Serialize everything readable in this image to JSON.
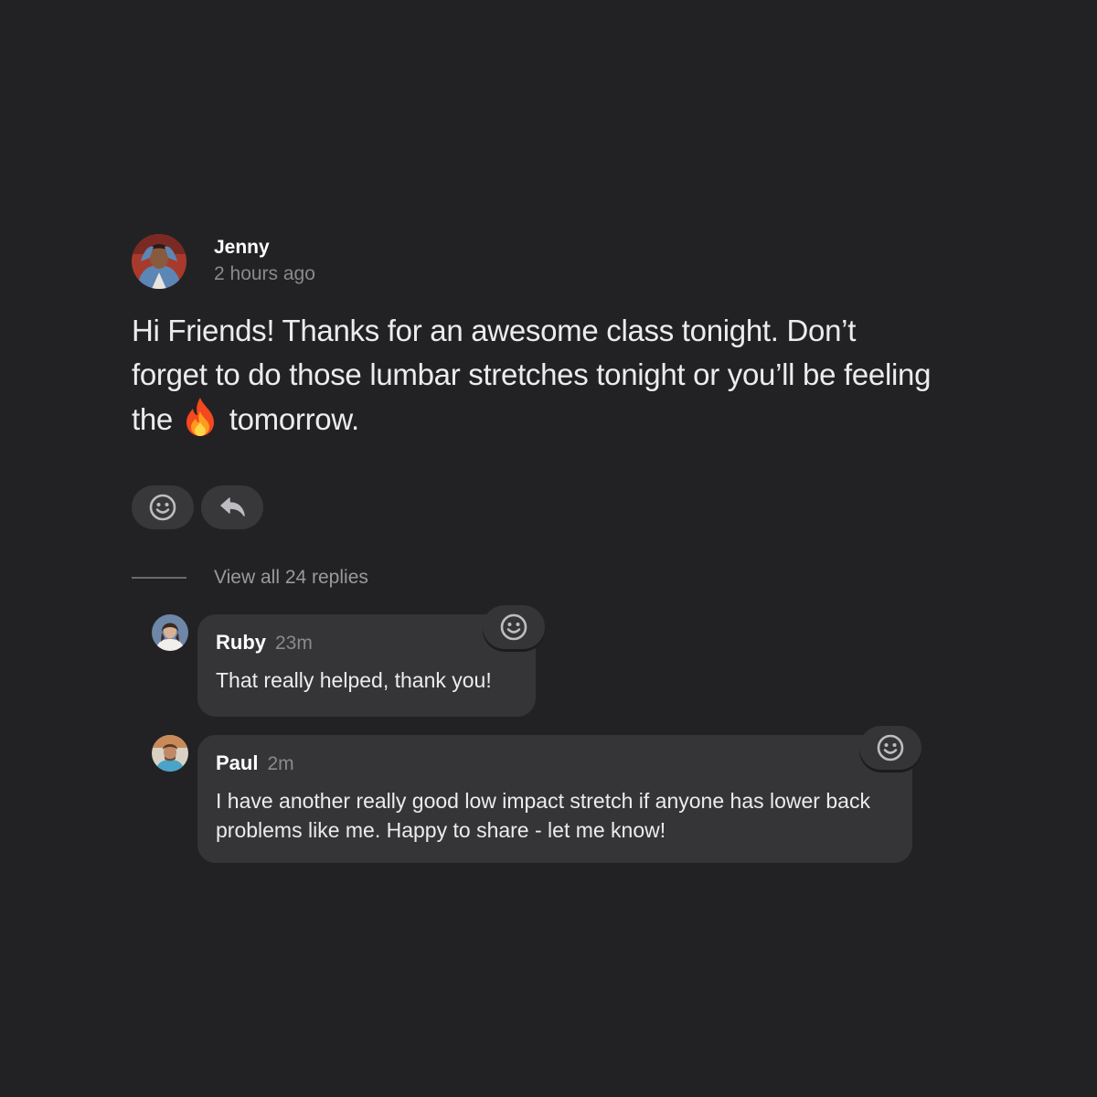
{
  "post": {
    "author": "Jenny",
    "time": "2 hours ago",
    "body_before_icon": "Hi Friends! Thanks for an awesome class tonight. Don’t forget to do those lumbar stretches tonight or you’ll be feeling the",
    "body_after_icon": "tomorrow.",
    "inline_icon": "fire-icon",
    "actions": [
      {
        "icon": "smiley-icon"
      },
      {
        "icon": "reply-arrow-icon"
      }
    ]
  },
  "replies_toggle": {
    "label": "View all 24 replies"
  },
  "replies": [
    {
      "author": "Ruby",
      "time": "23m",
      "text": "That really helped, thank you!",
      "react_icon": "smiley-icon"
    },
    {
      "author": "Paul",
      "time": "2m",
      "text": "I have another really good low impact stretch if anyone has lower back problems like me. Happy to share - let me know!",
      "react_icon": "smiley-icon"
    }
  ],
  "colors": {
    "background": "#222224",
    "surface": "#353537",
    "text_primary": "#ececee",
    "text_secondary": "#8a8a8e"
  }
}
